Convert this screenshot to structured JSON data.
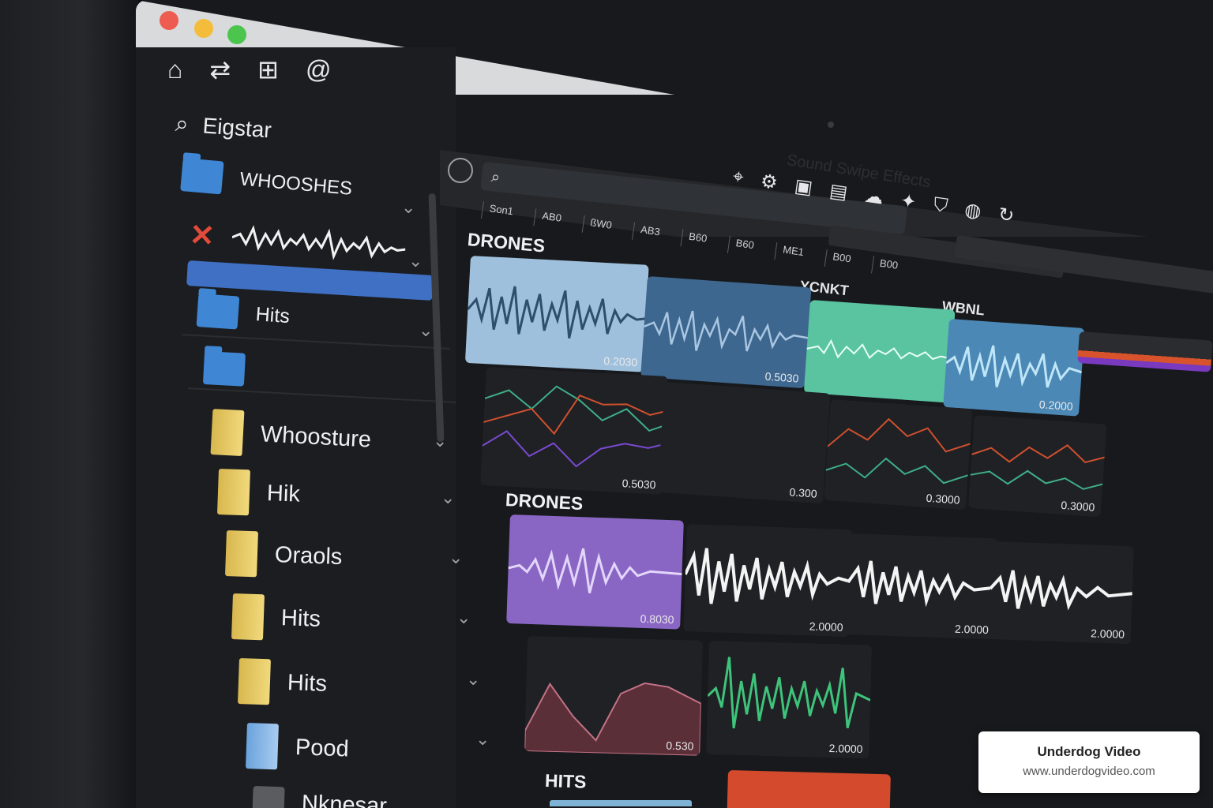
{
  "window": {
    "title": "Sound Swipe Effects",
    "controls": [
      "close",
      "minimize",
      "zoom"
    ]
  },
  "sidebar": {
    "top_icons": [
      "home-icon",
      "transfer-icon",
      "grid-icon",
      "at-icon"
    ],
    "search_label": "Eigstar",
    "items": [
      {
        "label": "WHOOSHES",
        "icon": "folder-icon"
      },
      {
        "label": "",
        "icon": "waveform-item"
      },
      {
        "label": "Hits",
        "icon": "folder-clock-icon"
      },
      {
        "label": "",
        "icon": "folder-icon"
      },
      {
        "label": "Whoosture",
        "icon": "yellow-folder-icon"
      },
      {
        "label": "Hik",
        "icon": "yellow-folder-icon"
      },
      {
        "label": "Oraols",
        "icon": "yellow-folder-icon"
      },
      {
        "label": "Hits",
        "icon": "yellow-folder-icon"
      },
      {
        "label": "Hits",
        "icon": "yellow-folder-icon"
      },
      {
        "label": "Pood",
        "icon": "blue-folder-icon"
      },
      {
        "label": "Nknesar",
        "icon": "gray-folder-icon"
      }
    ]
  },
  "toolbar": {
    "icons": [
      "scan-icon",
      "gear-icon",
      "monitor-icon",
      "clipboard-icon",
      "cloud-icon",
      "star-icon",
      "shield-icon",
      "globe-icon",
      "refresh-icon"
    ],
    "ruler_labels": [
      "Son1",
      "AB0",
      "ßW0",
      "AB3",
      "B60",
      "B60",
      "ME1",
      "B00",
      "B00"
    ]
  },
  "main": {
    "sections": [
      {
        "label": "DRONES",
        "headers": [
          "YCNKT",
          "WBNL"
        ],
        "cells": [
          {
            "kind": "wave",
            "color": "#9ec0dc",
            "value": "0.2030"
          },
          {
            "kind": "wave",
            "color": "#3d678f",
            "value": "0.5030"
          },
          {
            "kind": "wave",
            "color": "#5ac4a1",
            "value": ""
          },
          {
            "kind": "wave",
            "color": "#4b88b5",
            "value": "0.2000"
          },
          {
            "kind": "lines",
            "value": "0.5030"
          },
          {
            "kind": "empty",
            "value": "0.300"
          },
          {
            "kind": "lines",
            "value": "0.3000"
          },
          {
            "kind": "lines",
            "value": "0.3000"
          }
        ]
      },
      {
        "label": "DRONES",
        "cells": [
          {
            "kind": "wave",
            "color": "#8a66c4",
            "value": "0.8030"
          },
          {
            "kind": "wave",
            "color": "#ffffff",
            "value": "2.0000"
          },
          {
            "kind": "wave",
            "color": "#ffffff",
            "value": "2.0000"
          },
          {
            "kind": "wave",
            "color": "#ffffff",
            "value": "2.0000"
          },
          {
            "kind": "area",
            "value": "0.530"
          },
          {
            "kind": "wave",
            "color": "#3ec47a",
            "value": "2.0000"
          }
        ]
      },
      {
        "label": "HITS",
        "cells": [
          {
            "kind": "wave",
            "color": "#d44a2c",
            "value": ""
          }
        ]
      }
    ]
  },
  "badge": {
    "title": "Underdog Video",
    "url": "www.underdogvideo.com"
  }
}
